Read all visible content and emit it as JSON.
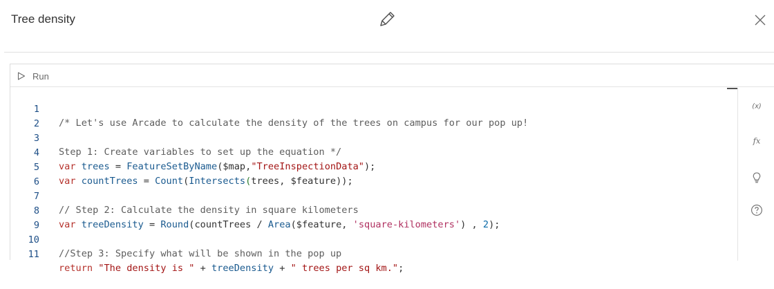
{
  "header": {
    "title": "Tree density"
  },
  "toolbar": {
    "run_label": "Run"
  },
  "sidebar": {
    "buttons": [
      {
        "icon": "variables-icon",
        "text": "(x)"
      },
      {
        "icon": "function-icon",
        "text": "fx"
      },
      {
        "icon": "lightbulb-icon",
        "text": ""
      },
      {
        "icon": "help-icon",
        "text": ""
      }
    ]
  },
  "code": {
    "line_numbers": [
      "1",
      "2",
      "3",
      "4",
      "5",
      "6",
      "7",
      "8",
      "9",
      "10",
      "11"
    ],
    "lines": [
      "/* Let's use Arcade to calculate the density of the trees on campus for our pop up!",
      "",
      "Step 1: Create variables to set up the equation */",
      "var trees = FeatureSetByName($map,\"TreeInspectionData\");",
      "var countTrees = Count(Intersects(trees, $feature));",
      "",
      "// Step 2: Calculate the density in square kilometers",
      "var treeDensity = Round(countTrees / Area($feature, 'square-kilometers') , 2);",
      "",
      "//Step 3: Specify what will be shown in the pop up",
      "return \"The density is \" + treeDensity + \" trees per sq km.\";"
    ],
    "tokens": {
      "l1": "/* Let's use Arcade to calculate the density of the trees on campus for our pop up!",
      "l3": "Step 1: Create variables to set up the equation */",
      "l4_kw": "var",
      "l4_var": "trees",
      "l4_eq": " = ",
      "l4_fn": "FeatureSetByName",
      "l4_open": "(",
      "l4_arg": "$map",
      "l4_comma": ",",
      "l4_str": "\"TreeInspectionData\"",
      "l4_close": ");",
      "l5_kw": "var",
      "l5_var": "countTrees",
      "l5_eq": " = ",
      "l5_fn1": "Count",
      "l5_p1": "(",
      "l5_fn2": "Intersects",
      "l5_p2": "(",
      "l5_a1": "trees",
      "l5_c": ", ",
      "l5_a2": "$feature",
      "l5_end": "));",
      "l7": "// Step 2: Calculate the density in square kilometers",
      "l8_kw": "var",
      "l8_var": "treeDensity",
      "l8_eq": " = ",
      "l8_fn1": "Round",
      "l8_p1": "(",
      "l8_a1": "countTrees",
      "l8_div": " / ",
      "l8_fn2": "Area",
      "l8_p2": "(",
      "l8_a2": "$feature",
      "l8_c": ", ",
      "l8_str": "'square-kilometers'",
      "l8_p3": ") , ",
      "l8_num": "2",
      "l8_end": ");",
      "l10": "//Step 3: Specify what will be shown in the pop up",
      "l11_kw": "return",
      "l11_s1": "\"The density is \"",
      "l11_plus1": " + ",
      "l11_var": "treeDensity",
      "l11_plus2": " + ",
      "l11_s2": "\" trees per sq km.\"",
      "l11_end": ";"
    }
  }
}
